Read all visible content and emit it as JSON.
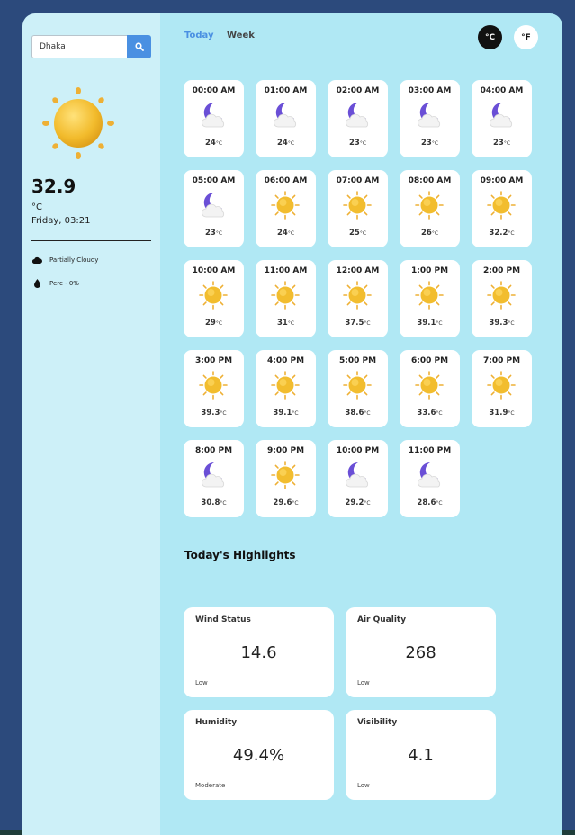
{
  "search": {
    "value": "Dhaka"
  },
  "current": {
    "temp": "32.9",
    "unit": "°C",
    "datetime": "Friday, 03:21",
    "condition": "Partially Cloudy",
    "precip": "Perc - 0%"
  },
  "tabs": {
    "today": "Today",
    "week": "Week"
  },
  "units": {
    "celsius": "°C",
    "fahrenheit": "°F"
  },
  "hourly": [
    {
      "time": "00:00 AM",
      "temp": "24",
      "icon": "moon-cloud-icon"
    },
    {
      "time": "01:00 AM",
      "temp": "24",
      "icon": "moon-cloud-icon"
    },
    {
      "time": "02:00 AM",
      "temp": "23",
      "icon": "moon-cloud-icon"
    },
    {
      "time": "03:00 AM",
      "temp": "23",
      "icon": "moon-cloud-icon"
    },
    {
      "time": "04:00 AM",
      "temp": "23",
      "icon": "moon-cloud-icon"
    },
    {
      "time": "05:00 AM",
      "temp": "23",
      "icon": "moon-cloud-icon"
    },
    {
      "time": "06:00 AM",
      "temp": "24",
      "icon": "sun-icon"
    },
    {
      "time": "07:00 AM",
      "temp": "25",
      "icon": "sun-icon"
    },
    {
      "time": "08:00 AM",
      "temp": "26",
      "icon": "sun-icon"
    },
    {
      "time": "09:00 AM",
      "temp": "32.2",
      "icon": "sun-icon"
    },
    {
      "time": "10:00 AM",
      "temp": "29",
      "icon": "sun-icon"
    },
    {
      "time": "11:00 AM",
      "temp": "31",
      "icon": "sun-icon"
    },
    {
      "time": "12:00 AM",
      "temp": "37.5",
      "icon": "sun-icon"
    },
    {
      "time": "1:00 PM",
      "temp": "39.1",
      "icon": "sun-icon"
    },
    {
      "time": "2:00 PM",
      "temp": "39.3",
      "icon": "sun-icon"
    },
    {
      "time": "3:00 PM",
      "temp": "39.3",
      "icon": "sun-icon"
    },
    {
      "time": "4:00 PM",
      "temp": "39.1",
      "icon": "sun-icon"
    },
    {
      "time": "5:00 PM",
      "temp": "38.6",
      "icon": "sun-icon"
    },
    {
      "time": "6:00 PM",
      "temp": "33.6",
      "icon": "sun-icon"
    },
    {
      "time": "7:00 PM",
      "temp": "31.9",
      "icon": "sun-icon"
    },
    {
      "time": "8:00 PM",
      "temp": "30.8",
      "icon": "moon-cloud-icon"
    },
    {
      "time": "9:00 PM",
      "temp": "29.6",
      "icon": "sun-icon"
    },
    {
      "time": "10:00 PM",
      "temp": "29.2",
      "icon": "moon-cloud-icon"
    },
    {
      "time": "11:00 PM",
      "temp": "28.6",
      "icon": "moon-cloud-icon"
    }
  ],
  "highlights": {
    "title": "Today's Highlights",
    "wind": {
      "label": "Wind Status",
      "value": "14.6",
      "status": "Low"
    },
    "air": {
      "label": "Air Quality",
      "value": "268",
      "status": "Low"
    },
    "humidity": {
      "label": "Humidity",
      "value": "49.4%",
      "status": "Moderate"
    },
    "visibility": {
      "label": "Visibility",
      "value": "4.1",
      "status": "Low"
    }
  },
  "colors": {
    "accent": "#4a90e2",
    "sidebar": "#cdf0f8",
    "main": "#b0e8f4",
    "background": "#2c4a7c"
  }
}
